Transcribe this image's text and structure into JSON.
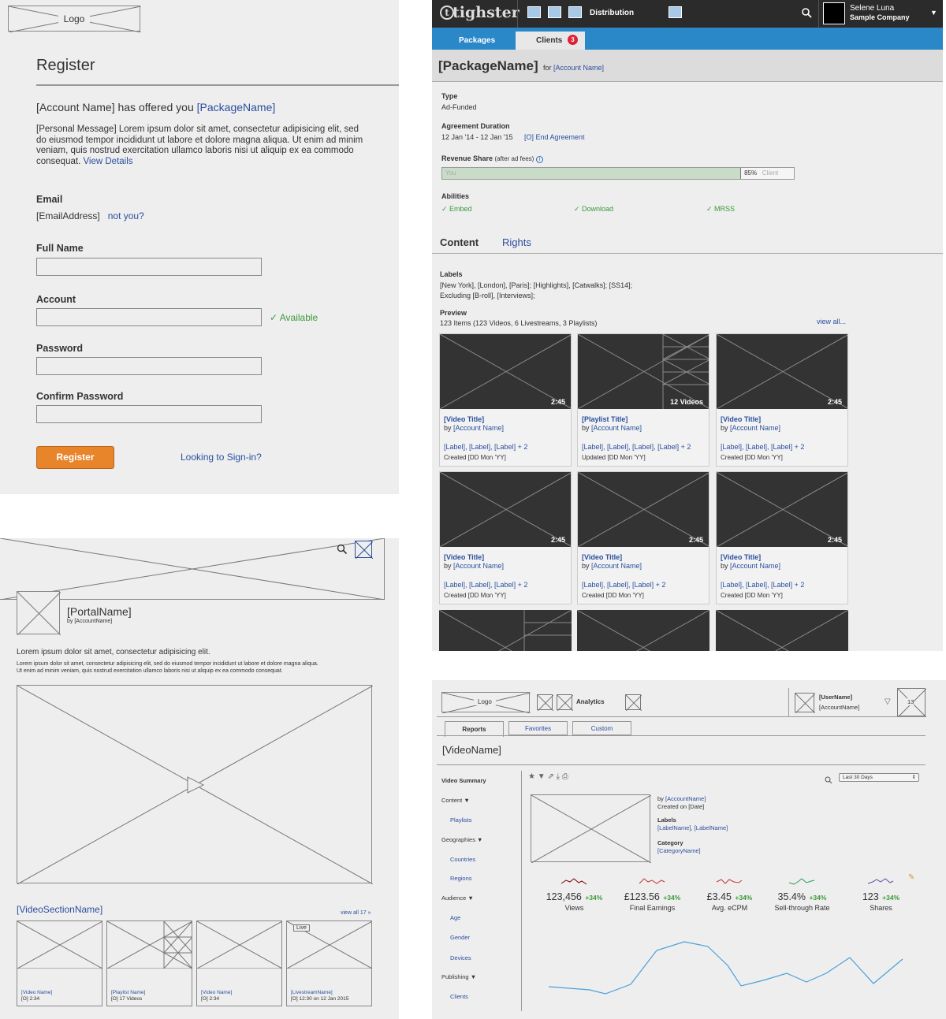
{
  "register": {
    "logo": "Logo",
    "title": "Register",
    "offer_prefix": "[Account Name] has offered you ",
    "offer_package": "[PackageName]",
    "message": "[Personal Message] Lorem ipsum dolor sit amet, consectetur adipisicing elit, sed do eiusmod tempor incididunt ut labore et dolore magna aliqua. Ut enim ad minim veniam, quis nostrud exercitation ullamco laboris nisi ut aliquip ex ea commodo consequat.",
    "view_details": "View Details",
    "email_label": "Email",
    "email_value": "[EmailAddress]",
    "not_you": "not you?",
    "full_name_label": "Full Name",
    "account_label": "Account",
    "available": "✓ Available",
    "password_label": "Password",
    "confirm_label": "Confirm Password",
    "register_button": "Register",
    "signin_link": "Looking to Sign-in?"
  },
  "package": {
    "brand": "tighster",
    "brand_t": "t",
    "nav_distribution": "Distribution",
    "user_name": "Selene Luna",
    "user_company": "Sample Company",
    "tab_packages": "Packages",
    "tab_clients": "Clients",
    "clients_badge": "3",
    "title": "[PackageName]",
    "for_text": "for",
    "account_link": "[Account Name]",
    "type_label": "Type",
    "type_value": "Ad-Funded",
    "duration_label": "Agreement Duration",
    "duration_value": "12 Jan '14 - 12 Jan '15",
    "end_agreement": "[O] End Agreement",
    "revenue_label": "Revenue Share",
    "revenue_note": "(after ad fees)",
    "revenue_you": "You",
    "revenue_pct": "85%",
    "revenue_client": "Client",
    "revenue_share": 0.85,
    "abilities_label": "Abilities",
    "ability_1": "✓ Embed",
    "ability_2": "✓ Download",
    "ability_3": "✓ MRSS",
    "tab_content": "Content",
    "tab_rights": "Rights",
    "labels_label": "Labels",
    "labels_line1": "[New York], [London], [Paris]; [Highlights], [Catwalks]; [SS14];",
    "labels_line2": "Excluding [B-roll], [Interviews];",
    "preview_label": "Preview",
    "preview_count": "123 Items (123 Videos, 6 Livestreams, 3 Playlists)",
    "view_all": "view all...",
    "cards": [
      {
        "badge": "2:45",
        "title": "[Video Title]",
        "by": "by",
        "account": "[Account Name]",
        "labels": "[Label], [Label], [Label] + 2",
        "date": "Created [DD Mon 'YY]"
      },
      {
        "badge": "12 Videos",
        "title": "[Playlist Title]",
        "by": "by",
        "account": "[Account Name]",
        "labels": "[Label], [Label], [Label], [Label] + 2",
        "date": "Updated [DD Mon 'YY]"
      },
      {
        "badge": "2:45",
        "title": "[Video Title]",
        "by": "by",
        "account": "[Account Name]",
        "labels": "[Label], [Label], [Label] + 2",
        "date": "Created [DD Mon 'YY]"
      },
      {
        "badge": "2:45",
        "title": "[Video Title]",
        "by": "by",
        "account": "[Account Name]",
        "labels": "[Label], [Label], [Label] + 2",
        "date": "Created [DD Mon 'YY]"
      },
      {
        "badge": "2:45",
        "title": "[Video Title]",
        "by": "by",
        "account": "[Account Name]",
        "labels": "[Label], [Label], [Label] + 2",
        "date": "Created [DD Mon 'YY]"
      },
      {
        "badge": "2:45",
        "title": "[Video Title]",
        "by": "by",
        "account": "[Account Name]",
        "labels": "[Label], [Label], [Label] + 2",
        "date": "Created [DD Mon 'YY]"
      }
    ]
  },
  "portal": {
    "name": "[PortalName]",
    "by": "by [AccountName]",
    "lead": "Lorem ipsum dolor sit amet, consectetur adipisicing elit.",
    "body": "Lorem ipsum dolor sit amet, consectetur adipisicing elit, sed do eiusmod tempor incididunt ut labore et dolore magna aliqua. Ut enim ad minim veniam, quis nostrud exercitation ullamco laboris nisi ut aliquip ex ea commodo consequat.",
    "section_name": "[VideoSectionName]",
    "view_all": "view all 17 »",
    "live_badge": "Live",
    "items": [
      {
        "name": "[Video Name]",
        "meta": "[O] 2:34"
      },
      {
        "name": "[Playlist Name]",
        "meta": "[O] 17 Videos"
      },
      {
        "name": "[Video Name]",
        "meta": "[O] 2:34"
      },
      {
        "name": "[LivestreamName]",
        "meta": "[O] 12:30 on 12 Jan 2015"
      }
    ]
  },
  "analytics": {
    "logo": "Logo",
    "nav_analytics": "Analytics",
    "user_name": "[UserName]",
    "account_name": "[AccountName]",
    "notif_count": "13",
    "tab_reports": "Reports",
    "tab_favorites": "Favorites",
    "tab_custom": "Custom",
    "video_name": "[VideoName]",
    "side_summary": "Video Summary",
    "side_content": "Content ▼",
    "side_playlists": "Playlists",
    "side_geographies": "Geographies ▼",
    "side_countries": "Countries",
    "side_regions": "Regions",
    "side_audience": "Audience ▼",
    "side_age": "Age",
    "side_gender": "Gender",
    "side_devices": "Devices",
    "side_publishing": "Publishing ▼",
    "side_clients": "Clients",
    "date_range": "Last 30 Days",
    "by_prefix": "by",
    "account_link": "[AccountName]",
    "created_on": "Created on [Date]",
    "labels_label": "Labels",
    "labels_value": "[LabelName], [LabelName]",
    "category_label": "Category",
    "category_value": "[CategoryName]",
    "stats": [
      {
        "value": "123,456",
        "change": "+34%",
        "label": "Views",
        "color": "#7a0000"
      },
      {
        "value": "£123.56",
        "change": "+34%",
        "label": "Final Earnings",
        "color": "#cc3333"
      },
      {
        "value": "£3.45",
        "change": "+34%",
        "label": "Avg. eCPM",
        "color": "#cc3333"
      },
      {
        "value": "35.4%",
        "change": "+34%",
        "label": "Sell-through Rate",
        "color": "#2a9a5a"
      },
      {
        "value": "123",
        "change": "+34%",
        "label": "Shares",
        "color": "#6a4aa0"
      }
    ]
  }
}
